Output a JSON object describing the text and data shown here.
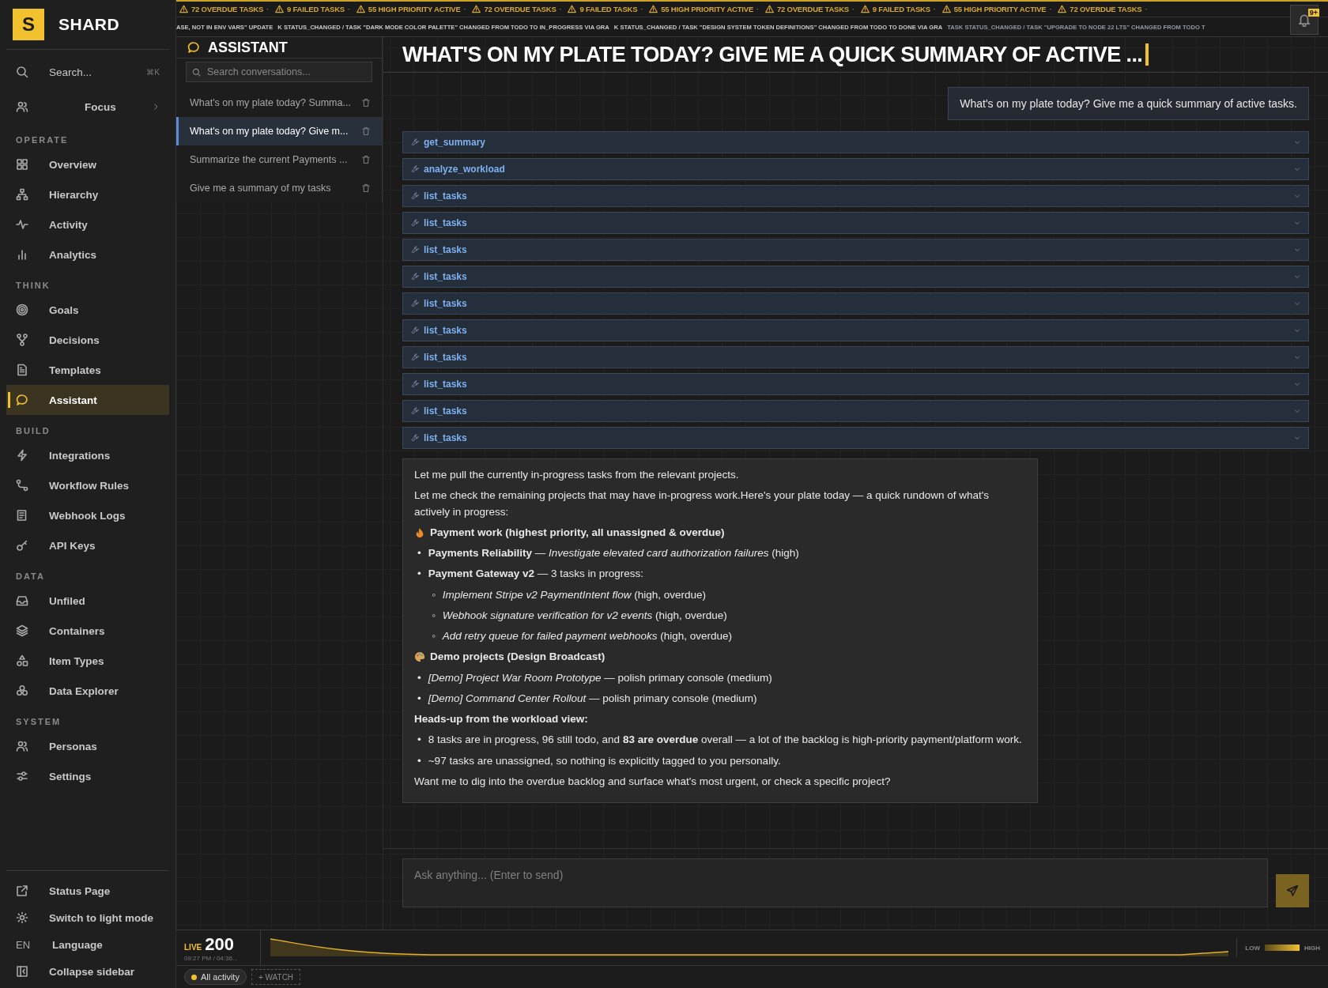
{
  "ticker": {
    "alerts": [
      {
        "text": "72 OVERDUE TASKS",
        "sep": "·"
      },
      {
        "text": "9 FAILED TASKS",
        "sep": "·"
      },
      {
        "text": "55 HIGH PRIORITY ACTIVE",
        "sep": "·"
      },
      {
        "text": "72 OVERDUE TASKS",
        "sep": "·"
      },
      {
        "text": "9 FAILED TASKS",
        "sep": "·"
      },
      {
        "text": "55 HIGH PRIORITY ACTIVE",
        "sep": "·"
      },
      {
        "text": "72 OVERDUE TASKS",
        "sep": "·"
      },
      {
        "text": "9 FAILED TASKS",
        "sep": "·"
      },
      {
        "text": "55 HIGH PRIORITY ACTIVE",
        "sep": "·"
      },
      {
        "text": "72 OVERDUE TASKS",
        "sep": "·"
      }
    ],
    "events": [
      "ASE, NOT IN ENV VARS\" UPDATE",
      "K STATUS_CHANGED / TASK \"DARK MODE COLOR PALETTE\" CHANGED FROM TODO TO IN_PROGRESS VIA GRA",
      "K STATUS_CHANGED / TASK \"DESIGN SYSTEM TOKEN DEFINITIONS\" CHANGED FROM TODO TO DONE VIA GRA",
      "TASK STATUS_CHANGED / TASK \"UPGRADE TO NODE 22 LTS\" CHANGED FROM TODO T"
    ]
  },
  "notifications": {
    "count": "9+"
  },
  "sidebar": {
    "brand": {
      "logo": "S",
      "name": "SHARD"
    },
    "search": {
      "placeholder": "Search...",
      "shortcut": "⌘K"
    },
    "focus": {
      "label": "Focus"
    },
    "sections": [
      {
        "title": "OPERATE",
        "items": [
          {
            "label": "Overview",
            "selected": false
          },
          {
            "label": "Hierarchy",
            "selected": false
          },
          {
            "label": "Activity",
            "selected": false
          },
          {
            "label": "Analytics",
            "selected": false
          }
        ]
      },
      {
        "title": "THINK",
        "items": [
          {
            "label": "Goals",
            "selected": false
          },
          {
            "label": "Decisions",
            "selected": false
          },
          {
            "label": "Templates",
            "selected": false
          },
          {
            "label": "Assistant",
            "selected": true
          }
        ]
      },
      {
        "title": "BUILD",
        "items": [
          {
            "label": "Integrations",
            "selected": false
          },
          {
            "label": "Workflow Rules",
            "selected": false
          },
          {
            "label": "Webhook Logs",
            "selected": false
          },
          {
            "label": "API Keys",
            "selected": false
          }
        ]
      },
      {
        "title": "DATA",
        "items": [
          {
            "label": "Unfiled",
            "selected": false
          },
          {
            "label": "Containers",
            "selected": false
          },
          {
            "label": "Item Types",
            "selected": false
          },
          {
            "label": "Data Explorer",
            "selected": false
          }
        ]
      },
      {
        "title": "SYSTEM",
        "items": [
          {
            "label": "Personas",
            "selected": false
          },
          {
            "label": "Settings",
            "selected": false
          }
        ]
      }
    ],
    "footer": [
      {
        "label": "Status Page",
        "kind": "icon"
      },
      {
        "label": "Switch to light mode",
        "kind": "icon"
      },
      {
        "label": "Language",
        "kind": "code",
        "code": "EN"
      },
      {
        "label": "Collapse sidebar",
        "kind": "icon"
      }
    ]
  },
  "conversations": {
    "title": "ASSISTANT",
    "search": {
      "placeholder": "Search conversations..."
    },
    "items": [
      {
        "title": "What's on my plate today? Summa...",
        "selected": false
      },
      {
        "title": "What's on my plate today? Give m...",
        "selected": true
      },
      {
        "title": "Summarize the current Payments ...",
        "selected": false
      },
      {
        "title": "Give me a summary of my tasks",
        "selected": false
      }
    ]
  },
  "chat": {
    "title": "WHAT'S ON MY PLATE TODAY? GIVE ME A QUICK SUMMARY OF ACTIVE ...",
    "user_message": "What's on my plate today? Give me a quick summary of active tasks.",
    "tool_calls": [
      "get_summary",
      "analyze_workload",
      "list_tasks",
      "list_tasks",
      "list_tasks",
      "list_tasks",
      "list_tasks",
      "list_tasks",
      "list_tasks",
      "list_tasks",
      "list_tasks",
      "list_tasks"
    ],
    "response": [
      {
        "kind": "p",
        "text": "Let me pull the currently in-progress tasks from the relevant projects."
      },
      {
        "kind": "p",
        "text": "Let me check the remaining projects that may have in-progress work.Here's your plate today — a quick rundown of what's actively in progress:"
      },
      {
        "kind": "emoji-heading",
        "text": "Payment work (highest priority, all unassigned & overdue)"
      },
      {
        "kind": "list",
        "items": [
          {
            "marker": "•",
            "text": "**Payments Reliability** — *Investigate elevated card authorization failures* (high)"
          },
          {
            "marker": "•",
            "text": "**Payment Gateway v2** — 3 tasks in progress:",
            "children": [
              {
                "marker": "◦",
                "text": "*Implement Stripe v2 PaymentIntent flow* (high, overdue)"
              },
              {
                "marker": "◦",
                "text": "*Webhook signature verification for v2 events* (high, overdue)"
              },
              {
                "marker": "◦",
                "text": "*Add retry queue for failed payment webhooks* (high, overdue)"
              }
            ]
          }
        ]
      },
      {
        "kind": "emoji-heading",
        "text": "Demo projects (Design Broadcast)"
      },
      {
        "kind": "list",
        "items": [
          {
            "marker": "•",
            "text": "*[Demo] Project War Room Prototype* — polish primary console (medium)"
          },
          {
            "marker": "•",
            "text": "*[Demo] Command Center Rollout* — polish primary console (medium)"
          }
        ]
      },
      {
        "kind": "heading",
        "text": "Heads-up from the workload view:"
      },
      {
        "kind": "list",
        "items": [
          {
            "marker": "•",
            "text": "8 tasks are in progress, 96 still todo, and **83 are overdue** overall — a lot of the backlog is high-priority payment/platform work."
          },
          {
            "marker": "•",
            "text": "~97 tasks are unassigned, so nothing is explicitly tagged to you personally."
          }
        ]
      },
      {
        "kind": "p",
        "text": "Want me to dig into the overdue backlog and surface what's most urgent, or check a specific project?"
      }
    ],
    "composer": {
      "placeholder": "Ask anything... (Enter to send)"
    }
  },
  "live": {
    "label": "LIVE",
    "count": "200",
    "time": "09:27 PM / 04:36...",
    "legend_low": "LOW",
    "legend_high": "HIGH",
    "filters": [
      {
        "label": "All activity",
        "kind": "chip"
      },
      {
        "label": "+ WATCH",
        "kind": "add"
      }
    ]
  }
}
